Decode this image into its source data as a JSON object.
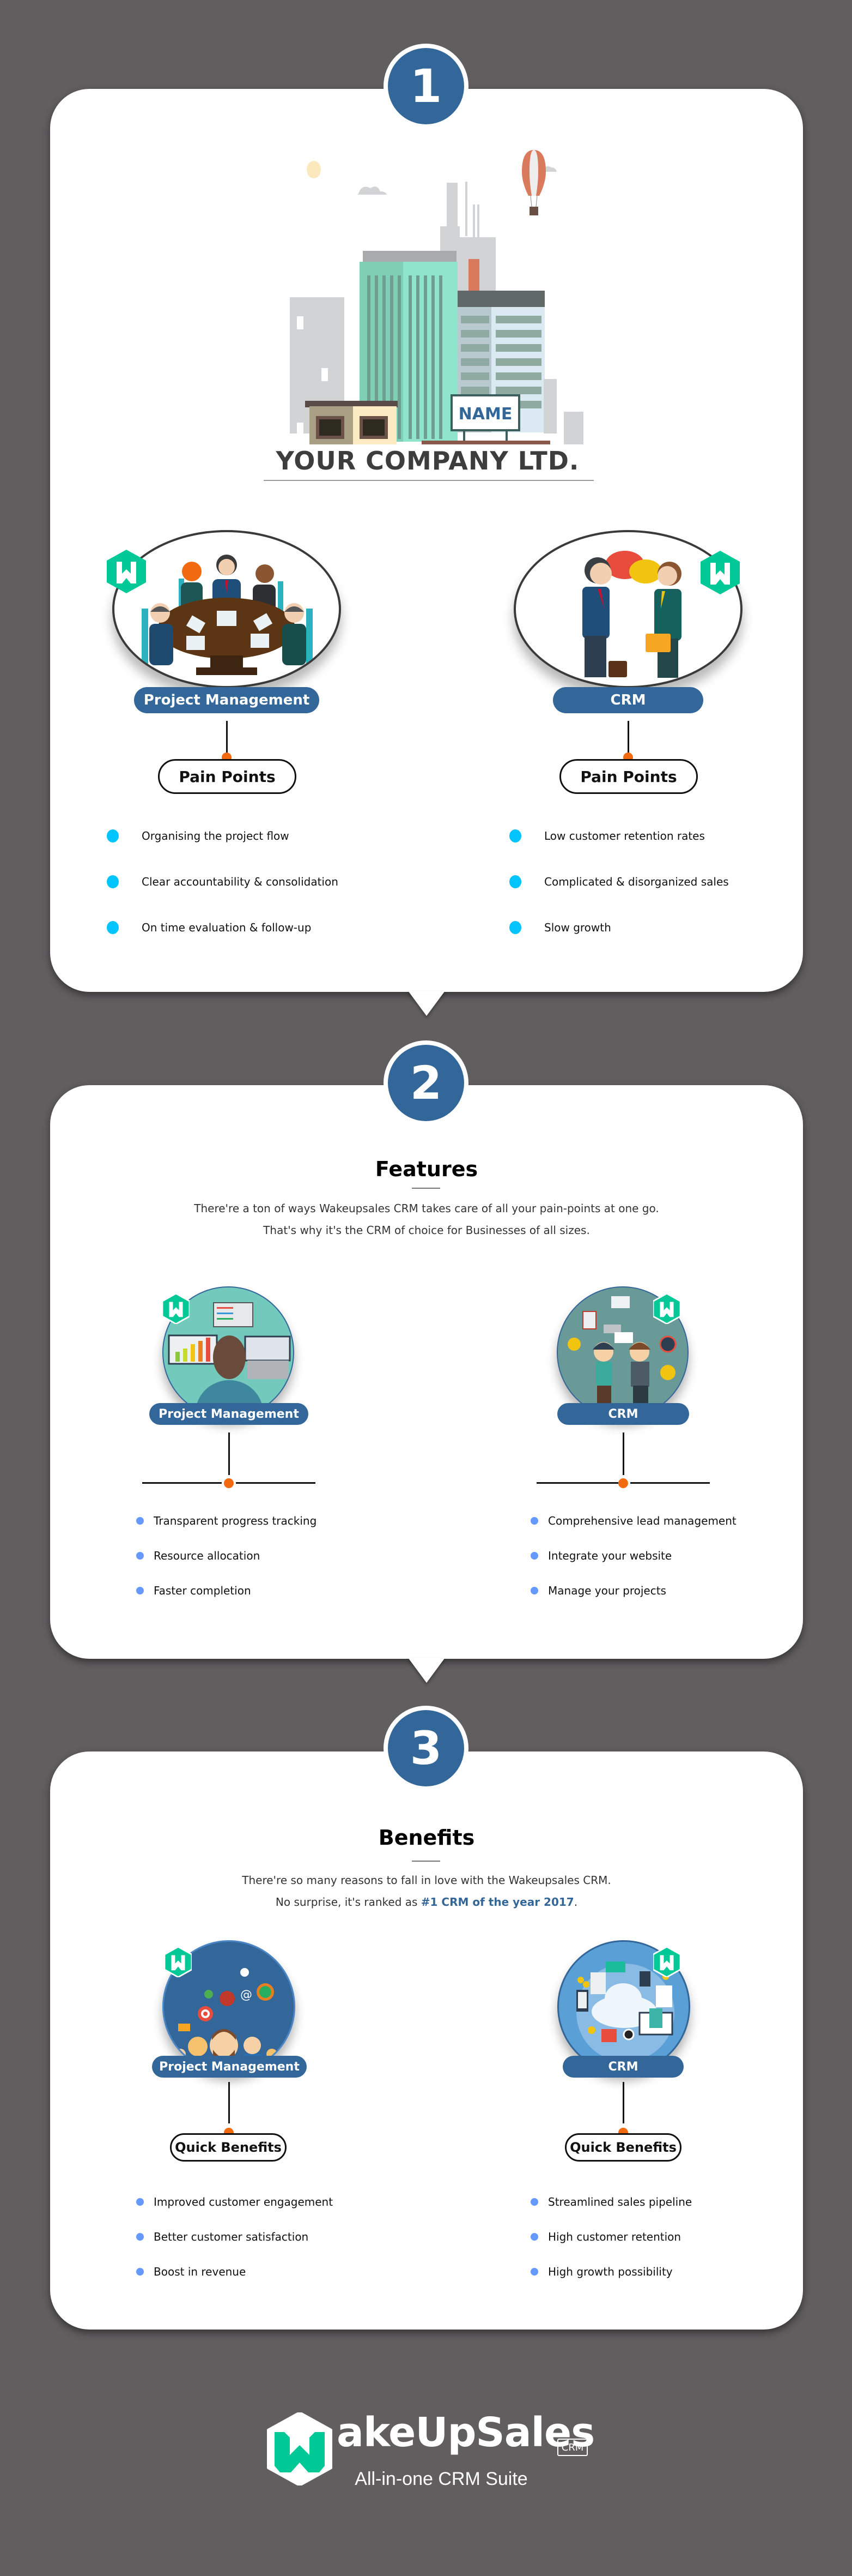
{
  "colors": {
    "background": "#605e5f",
    "card": "#ffffff",
    "brand_blue": "#336699",
    "brand_green": "#00c896",
    "accent_orange": "#f26a10",
    "pain_bullet": "#00c4ff",
    "feature_bullet": "#6699ff"
  },
  "section1": {
    "number": "1",
    "illustration": "city-buildings-illustration",
    "sign_text": "NAME",
    "company_name": "YOUR COMPANY LTD.",
    "columns": [
      {
        "category": "Project Management",
        "illustration": "meeting-table-illustration",
        "heading": "Pain Points",
        "items": [
          "Organising the project flow",
          "Clear accountability & consolidation",
          "On time evaluation & follow-up"
        ]
      },
      {
        "category": "CRM",
        "illustration": "handshake-conversation-illustration",
        "heading": "Pain Points",
        "items": [
          "Low customer retention rates",
          "Complicated & disorganized sales",
          "Slow growth"
        ]
      }
    ]
  },
  "section2": {
    "number": "2",
    "title": "Features",
    "description_line1": "There're a ton of ways Wakeupsales CRM takes care of all your pain-points at one go.",
    "description_line2": "That's why it's the CRM of choice for Businesses of all sizes.",
    "columns": [
      {
        "category": "Project Management",
        "illustration": "analytics-workstation-illustration",
        "items": [
          "Transparent progress tracking",
          "Resource allocation",
          "Faster completion"
        ]
      },
      {
        "category": "CRM",
        "illustration": "business-handshake-illustration",
        "items": [
          "Comprehensive lead management",
          "Integrate your website",
          "Manage your projects"
        ]
      }
    ]
  },
  "section3": {
    "number": "3",
    "title": "Benefits",
    "description_line1": "There're so many reasons to fall in love with the Wakeupsales CRM.",
    "description_line2_prefix": "No surprise, it's ranked as ",
    "description_line2_highlight": "#1 CRM of the year 2017",
    "description_line2_suffix": ".",
    "columns": [
      {
        "category": "Project Management",
        "illustration": "team-icons-illustration",
        "heading": "Quick Benefits",
        "items": [
          "Improved customer engagement",
          "Better customer satisfaction",
          "Boost in revenue"
        ]
      },
      {
        "category": "CRM",
        "illustration": "cloud-commerce-illustration",
        "heading": "Quick Benefits",
        "items": [
          "Streamlined sales pipeline",
          "High customer retention",
          "High growth possibility"
        ]
      }
    ]
  },
  "footer": {
    "brand": "akeUpSales",
    "crm_tag": "CRM",
    "tagline": "All-in-one CRM Suite",
    "logo_icon": "wakeupsales-w-logo"
  }
}
